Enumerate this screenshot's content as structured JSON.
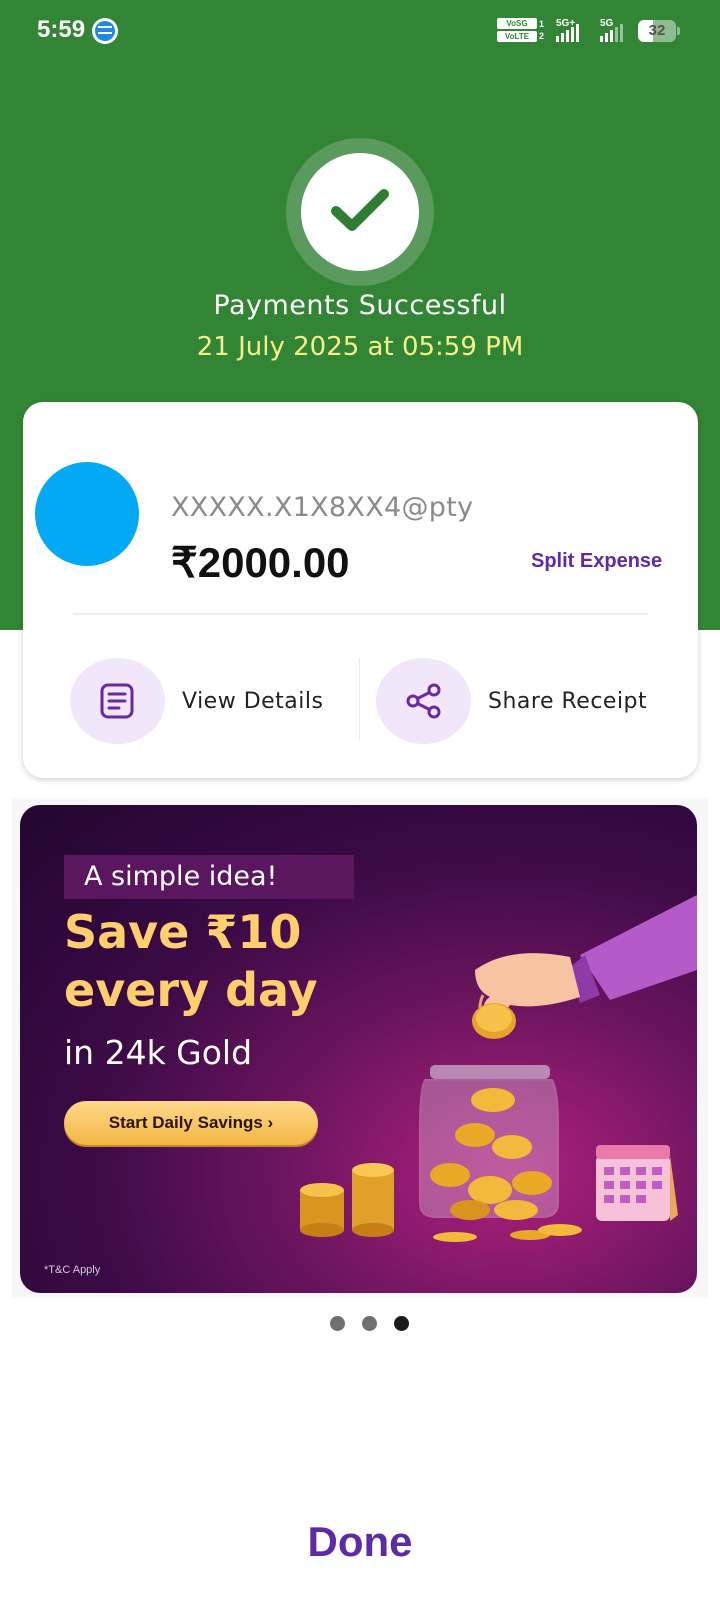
{
  "status_bar": {
    "time": "5:59",
    "volte_top": "VoSG",
    "volte_bottom": "VoLTE",
    "sim1": "1",
    "sim2": "2",
    "net1": "5G+",
    "net2": "5G",
    "battery": "32"
  },
  "payment": {
    "title": "Payments Successful",
    "datetime": "21 July 2025 at 05:59 PM"
  },
  "recipient": {
    "upi_id": "XXXXX.X1X8XX4@pty",
    "amount": "₹2000.00",
    "split_label": "Split Expense"
  },
  "actions": {
    "view_details": "View Details",
    "share_receipt": "Share Receipt"
  },
  "banner": {
    "tag": "A simple idea!",
    "headline_1": "Save ₹10",
    "headline_2": "every day",
    "subline": "in 24k Gold",
    "cta": "Start Daily Savings ›",
    "terms": "*T&C Apply",
    "slide_index": 3,
    "slide_count": 3
  },
  "footer": {
    "done": "Done"
  },
  "colors": {
    "header_green": "#318535",
    "accent_purple": "#5d2ba3",
    "avatar_blue": "#03a9f4",
    "date_yellow": "#f4f18a"
  },
  "icons": [
    "message-notification-icon",
    "signal-icon",
    "battery-icon",
    "check-icon",
    "document-icon",
    "share-icon"
  ]
}
